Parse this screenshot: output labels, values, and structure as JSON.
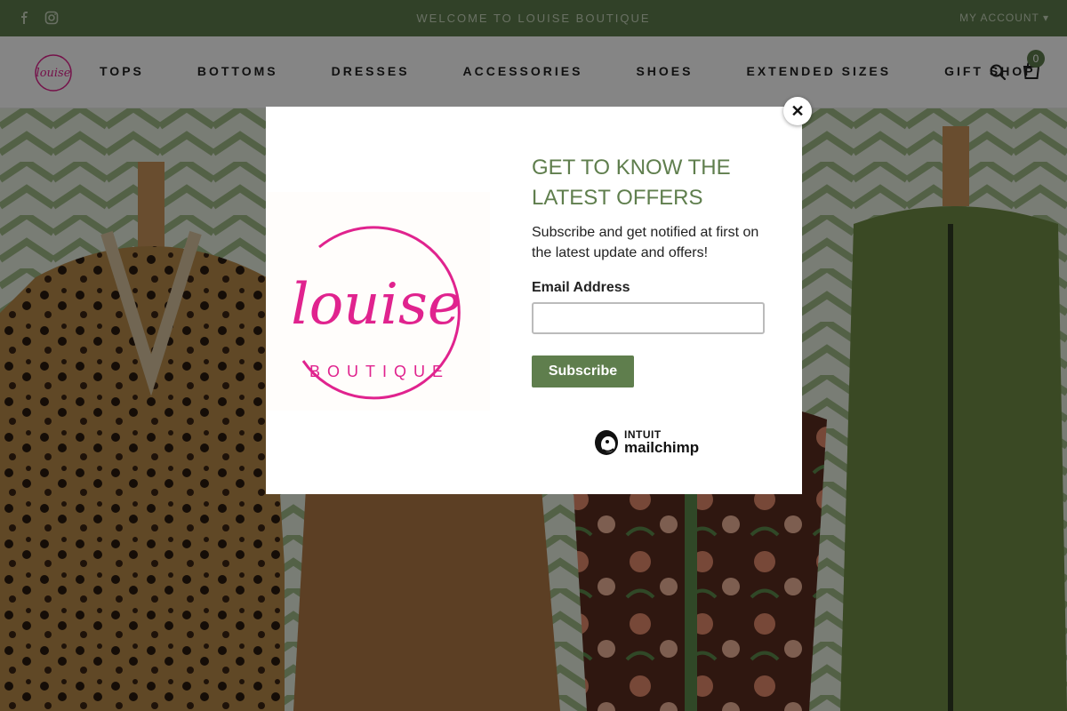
{
  "colors": {
    "brand_green": "#5f7e4d",
    "logo_pink": "#e0238e",
    "overlay": "rgba(0,0,0,0.48)"
  },
  "announcement": {
    "social_icons": [
      "facebook-icon",
      "instagram-icon"
    ],
    "welcome_text": "WELCOME TO LOUISE BOUTIQUE",
    "account_label": "MY ACCOUNT ▾"
  },
  "header": {
    "logo_alt": "Louise Boutique logo",
    "nav": [
      "TOPS",
      "BOTTOMS",
      "DRESSES",
      "ACCESSORIES",
      "SHOES",
      "EXTENDED SIZES",
      "GIFT SHOP"
    ],
    "search_icon": "search-icon",
    "cart_icon": "cart-icon",
    "cart_count": "0"
  },
  "popup": {
    "logo_script": "louise",
    "logo_sub": "BOUTIQUE",
    "heading": "GET TO KNOW THE LATEST OFFERS",
    "description": "Subscribe and get notified at first on the latest update and offers!",
    "email_label": "Email Address",
    "email_value": "",
    "subscribe_label": "Subscribe",
    "mailchimp_intuit": "INTUIT",
    "mailchimp_name": "mailchimp",
    "close_symbol": "✕"
  }
}
